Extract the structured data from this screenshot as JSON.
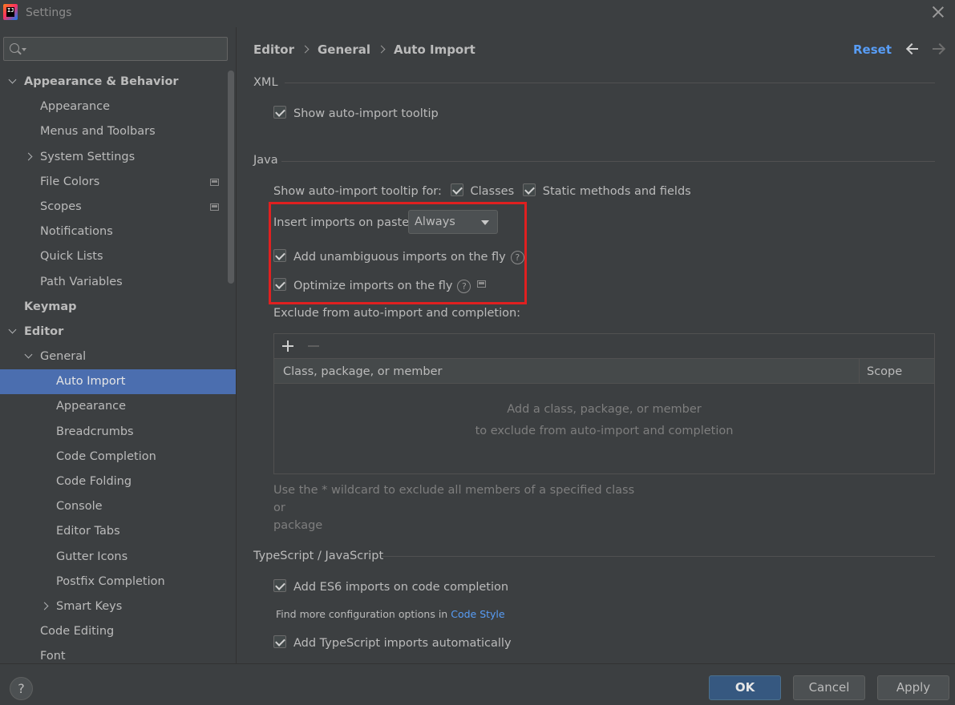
{
  "window": {
    "title": "Settings"
  },
  "search": {
    "placeholder": "",
    "value": ""
  },
  "sidebar": {
    "items": [
      {
        "label": "Appearance & Behavior",
        "level": 0,
        "bold": true,
        "expander": "down"
      },
      {
        "label": "Appearance",
        "level": 1
      },
      {
        "label": "Menus and Toolbars",
        "level": 1
      },
      {
        "label": "System Settings",
        "level": 1,
        "expander": "right"
      },
      {
        "label": "File Colors",
        "level": 1,
        "projectIcon": true
      },
      {
        "label": "Scopes",
        "level": 1,
        "projectIcon": true
      },
      {
        "label": "Notifications",
        "level": 1
      },
      {
        "label": "Quick Lists",
        "level": 1
      },
      {
        "label": "Path Variables",
        "level": 1
      },
      {
        "label": "Keymap",
        "level": 0,
        "bold": true
      },
      {
        "label": "Editor",
        "level": 0,
        "bold": true,
        "expander": "down"
      },
      {
        "label": "General",
        "level": 1,
        "expander": "down"
      },
      {
        "label": "Auto Import",
        "level": 2,
        "selected": true
      },
      {
        "label": "Appearance",
        "level": 2
      },
      {
        "label": "Breadcrumbs",
        "level": 2
      },
      {
        "label": "Code Completion",
        "level": 2
      },
      {
        "label": "Code Folding",
        "level": 2
      },
      {
        "label": "Console",
        "level": 2
      },
      {
        "label": "Editor Tabs",
        "level": 2
      },
      {
        "label": "Gutter Icons",
        "level": 2
      },
      {
        "label": "Postfix Completion",
        "level": 2
      },
      {
        "label": "Smart Keys",
        "level": 2,
        "expander": "right"
      },
      {
        "label": "Code Editing",
        "level": 1
      },
      {
        "label": "Font",
        "level": 1
      }
    ]
  },
  "breadcrumb": {
    "part1": "Editor",
    "part2": "General",
    "part3": "Auto Import"
  },
  "header": {
    "reset_label": "Reset"
  },
  "xml": {
    "title": "XML",
    "show_tooltip_label": "Show auto-import tooltip",
    "show_tooltip_checked": true
  },
  "java": {
    "title": "Java",
    "tooltip_for_label": "Show auto-import tooltip for:",
    "classes_label": "Classes",
    "classes_checked": true,
    "static_label": "Static methods and fields",
    "static_checked": true,
    "insert_on_paste_label": "Insert imports on paste:",
    "insert_on_paste_value": "Always",
    "add_unambiguous_label": "Add unambiguous imports on the fly",
    "add_unambiguous_checked": true,
    "optimize_label": "Optimize imports on the fly",
    "optimize_checked": true,
    "exclude_label": "Exclude from auto-import and completion:",
    "table": {
      "col_class": "Class, package, or member",
      "col_scope": "Scope",
      "empty_line1": "Add a class, package, or member",
      "empty_line2": "to exclude from auto-import and completion"
    },
    "hint_line1": "Use the * wildcard to exclude all members of a specified class or",
    "hint_line2": "package"
  },
  "typescript": {
    "title": "TypeScript / JavaScript",
    "es6_label": "Add ES6 imports on code completion",
    "es6_checked": true,
    "find_more_prefix": "Find more configuration options in",
    "find_more_link": "Code Style",
    "ts_auto_label": "Add TypeScript imports automatically",
    "ts_auto_checked": true
  },
  "buttons": {
    "help": "?",
    "ok": "OK",
    "cancel": "Cancel",
    "apply": "Apply"
  },
  "colors": {
    "background": "#3c3f41",
    "selection": "#4b6eaf",
    "link": "#589df6",
    "primary_button": "#365880",
    "highlight_box": "#e02020"
  }
}
